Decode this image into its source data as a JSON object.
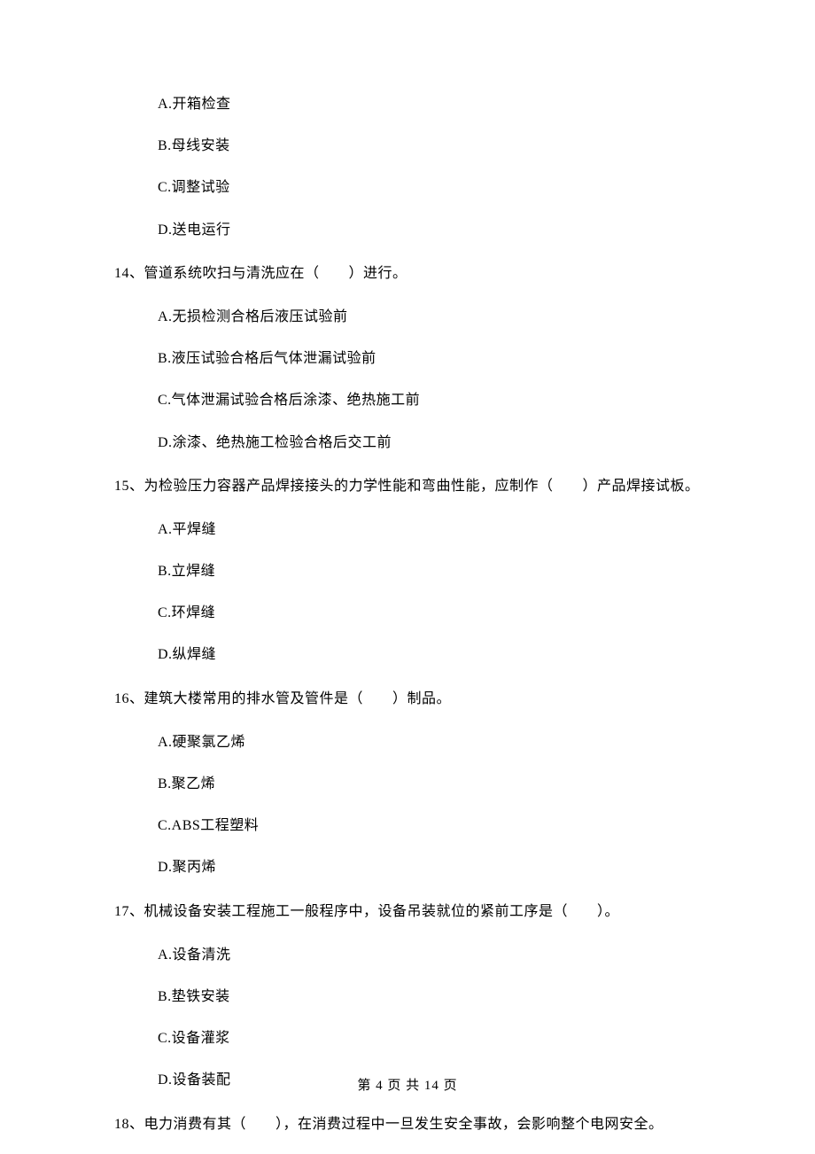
{
  "prev_options": {
    "A": "A.开箱检查",
    "B": "B.母线安装",
    "C": "C.调整试验",
    "D": "D.送电运行"
  },
  "q14": {
    "stem": "14、管道系统吹扫与清洗应在（　　）进行。",
    "A": "A.无损检测合格后液压试验前",
    "B": "B.液压试验合格后气体泄漏试验前",
    "C": "C.气体泄漏试验合格后涂漆、绝热施工前",
    "D": "D.涂漆、绝热施工检验合格后交工前"
  },
  "q15": {
    "stem": "15、为检验压力容器产品焊接接头的力学性能和弯曲性能，应制作（　　）产品焊接试板。",
    "A": "A.平焊缝",
    "B": "B.立焊缝",
    "C": "C.环焊缝",
    "D": "D.纵焊缝"
  },
  "q16": {
    "stem": "16、建筑大楼常用的排水管及管件是（　　）制品。",
    "A": "A.硬聚氯乙烯",
    "B": "B.聚乙烯",
    "C": "C.ABS工程塑料",
    "D": "D.聚丙烯"
  },
  "q17": {
    "stem": "17、机械设备安装工程施工一般程序中，设备吊装就位的紧前工序是（　　）。",
    "A": "A.设备清洗",
    "B": "B.垫铁安装",
    "C": "C.设备灌浆",
    "D": "D.设备装配"
  },
  "q18": {
    "stem": "18、电力消费有其（　　），在消费过程中一旦发生安全事故，会影响整个电网安全。"
  },
  "footer": "第 4 页 共 14 页"
}
